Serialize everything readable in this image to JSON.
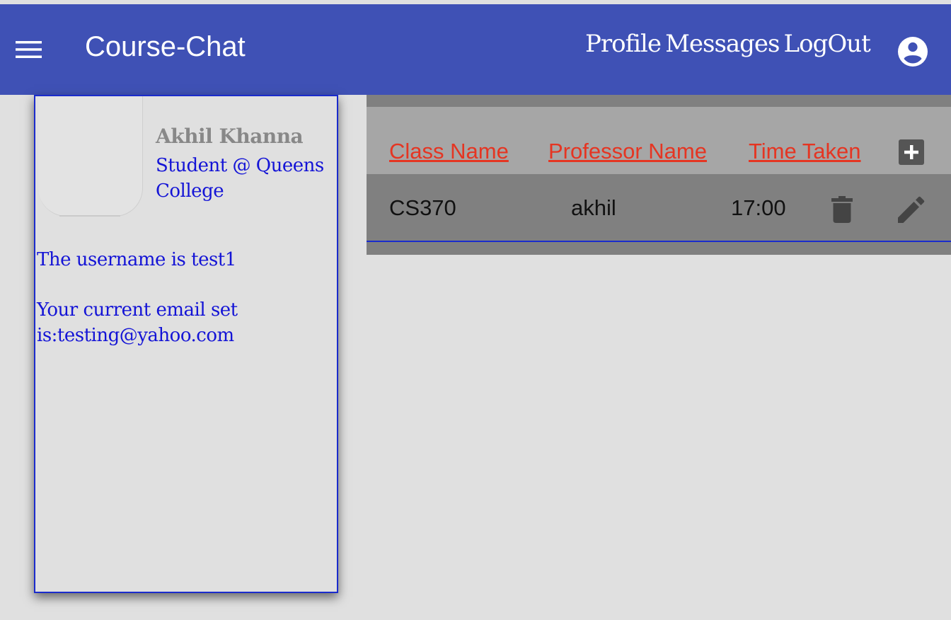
{
  "app": {
    "title": "Course-Chat"
  },
  "nav": {
    "profile": "Profile",
    "messages": "Messages",
    "logout": "LogOut"
  },
  "profile": {
    "name": "Akhil Khanna",
    "role": "Student @ Queens College",
    "username_text": "The username is test1",
    "email_text": "Your current email set is:testing@yahoo.com"
  },
  "table": {
    "headers": {
      "class_name": "Class Name",
      "professor_name": "Professor Name",
      "time_taken": "Time Taken"
    },
    "rows": [
      {
        "class_name": "CS370",
        "professor": "akhil",
        "time": "17:00"
      }
    ]
  },
  "icons": {
    "menu": "menu-icon",
    "account": "account-circle-icon",
    "add": "add-box-icon",
    "delete": "trash-icon",
    "edit": "pencil-icon"
  },
  "colors": {
    "appbar": "#3f51b5",
    "header_link": "#e53522",
    "profile_text": "#1414d6",
    "card_border": "#1a2bcc"
  }
}
